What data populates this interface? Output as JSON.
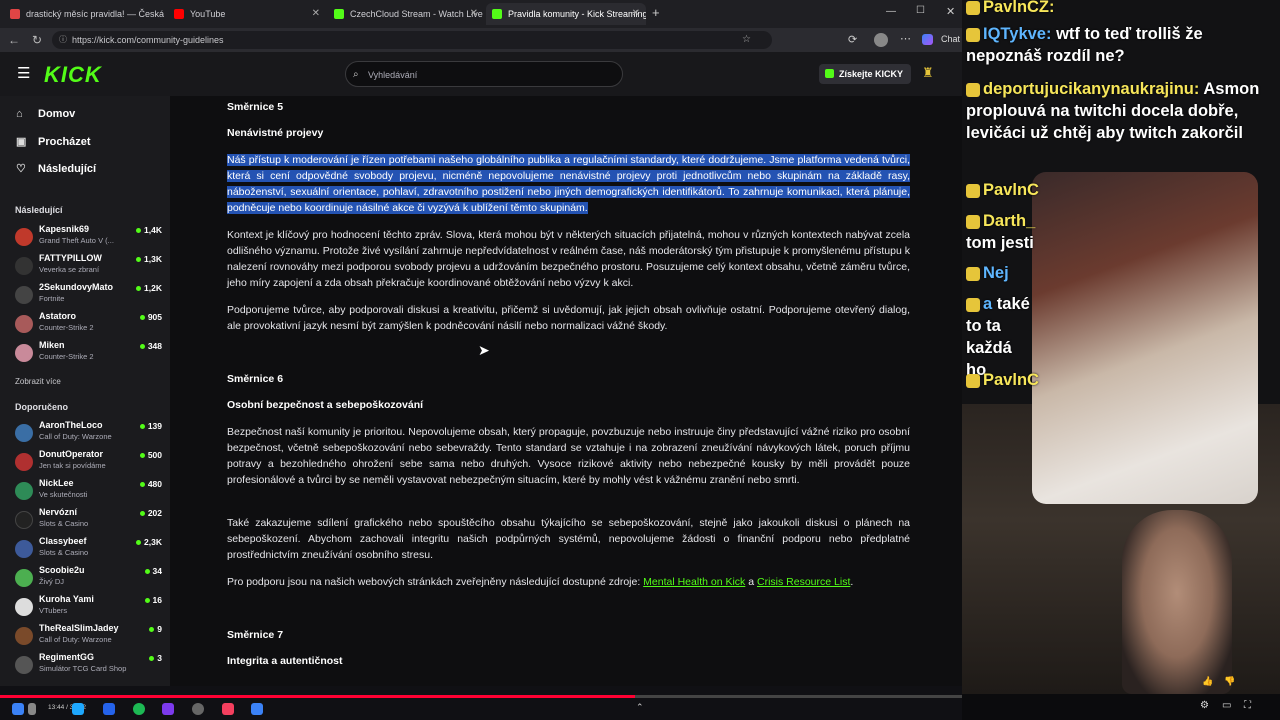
{
  "browser": {
    "tabs": [
      {
        "label": "drastický měsíc pravidla! — Česká t",
        "color": "#e04545"
      },
      {
        "label": "YouTube",
        "color": "#ff0000"
      },
      {
        "label": "CzechCloud Stream - Watch Live o",
        "color": "#53fc18"
      },
      {
        "label": "Pravidla komunity - Kick Streaming",
        "color": "#53fc18"
      }
    ],
    "url": "https://kick.com/community-guidelines",
    "chat_button": "Chat"
  },
  "header": {
    "logo": "KICK",
    "search_placeholder": "Vyhledávání",
    "kicky_button": "Získejte KICKY"
  },
  "sidebar": {
    "nav": [
      {
        "label": "Domov",
        "icon": "home-icon"
      },
      {
        "label": "Procházet",
        "icon": "browse-icon"
      },
      {
        "label": "Následující",
        "icon": "heart-icon"
      }
    ],
    "following_title": "Následující",
    "following": [
      {
        "name": "Kapesnik69",
        "category": "Grand Theft Auto V (...",
        "viewers": "1,4K",
        "color": "#c0392b"
      },
      {
        "name": "FATTYPILLOW",
        "category": "Veverka se zbraní",
        "viewers": "1,3K",
        "color": "#333333"
      },
      {
        "name": "2SekundovyMato",
        "category": "Fortnite",
        "viewers": "1,2K",
        "color": "#444444"
      },
      {
        "name": "Astatoro",
        "category": "Counter-Strike 2",
        "viewers": "905",
        "color": "#a85a5a"
      },
      {
        "name": "Miken",
        "category": "Counter-Strike 2",
        "viewers": "348",
        "color": "#c98a9a"
      }
    ],
    "show_more": "Zobrazit více",
    "recommended_title": "Doporučeno",
    "recommended": [
      {
        "name": "AaronTheLoco",
        "category": "Call of Duty: Warzone",
        "viewers": "139",
        "color": "#3a6ea5"
      },
      {
        "name": "DonutOperator",
        "category": "Jen tak si povídáme",
        "viewers": "500",
        "color": "#b03030"
      },
      {
        "name": "NickLee",
        "category": "Ve skutečnosti",
        "viewers": "480",
        "color": "#2e8b57"
      },
      {
        "name": "Nervózní",
        "category": "Slots & Casino",
        "viewers": "202",
        "color": "#222222"
      },
      {
        "name": "Classybeef",
        "category": "Slots & Casino",
        "viewers": "2,3K",
        "color": "#3d5a9a"
      },
      {
        "name": "Scoobie2u",
        "category": "Živý DJ",
        "viewers": "34",
        "color": "#4caf50"
      },
      {
        "name": "Kuroha Yami",
        "category": "VTubers",
        "viewers": "16",
        "color": "#dddddd"
      },
      {
        "name": "TheRealSlimJadey",
        "category": "Call of Duty: Warzone",
        "viewers": "9",
        "color": "#7a4a2a"
      },
      {
        "name": "RegimentGG",
        "category": "Simulátor TCG Card Shop",
        "viewers": "3",
        "color": "#555555"
      }
    ]
  },
  "content": {
    "s5_title": "Směrnice 5",
    "s5_sub": "Nenávistné projevy",
    "s5_p1": "Náš přístup k moderování je řízen potřebami našeho globálního publika a regulačními standardy, které dodržujeme. Jsme platforma vedená tvůrci, která si cení odpovědné svobody projevu, nicméně nepovolujeme nenávistné projevy proti jednotlivcům nebo skupinám na základě rasy, náboženství, sexuální orientace, pohlaví, zdravotního postižení nebo jiných demografických identifikátorů. To zahrnuje komunikaci, která plánuje, podněcuje nebo koordinuje násilné akce či vyzývá k ublížení těmto skupinám.",
    "s5_p2": "Kontext je klíčový pro hodnocení těchto zpráv. Slova, která mohou být v některých situacích přijatelná, mohou v různých kontextech nabývat zcela odlišného významu. Protože živé vysílání zahrnuje nepředvídatelnost v reálném čase, náš moderátorský tým přistupuje k promyšlenému přístupu k nalezení rovnováhy mezi podporou svobody projevu a udržováním bezpečného prostoru. Posuzujeme celý kontext obsahu, včetně záměru tvůrce, jeho míry zapojení a zda obsah překračuje koordinované obtěžování nebo výzvy k akci.",
    "s5_p3": "Podporujeme tvůrce, aby podporovali diskusi a kreativitu, přičemž si uvědomují, jak jejich obsah ovlivňuje ostatní. Podporujeme otevřený dialog, ale provokativní jazyk nesmí být zamýšlen k podněcování násilí nebo normalizaci vážné škody.",
    "s6_title": "Směrnice 6",
    "s6_sub": "Osobní bezpečnost a sebepoškozování",
    "s6_p1": "Bezpečnost naší komunity je prioritou. Nepovolujeme obsah, který propaguje, povzbuzuje nebo instruuje činy představující vážné riziko pro osobní bezpečnost, včetně sebepoškozování nebo sebevraždy. Tento standard se vztahuje i na zobrazení zneužívání návykových látek, poruch příjmu potravy a bezohledného ohrožení sebe sama nebo druhých. Vysoce rizikové aktivity nebo nebezpečné kousky by měli provádět pouze profesionálové a tvůrci by se neměli vystavovat nebezpečným situacím, které by mohly vést k vážnému zranění nebo smrti.",
    "s6_p2": "Také zakazujeme sdílení grafického nebo spouštěcího obsahu týkajícího se sebepoškozování, stejně jako jakoukoli diskusi o plánech na sebepoškození. Abychom zachovali integritu našich podpůrných systémů, nepovolujeme žádosti o finanční podporu nebo předplatné prostřednictvím zneužívání osobního stresu.",
    "s6_p3_prefix": "Pro podporu jsou na našich webových stránkách zveřejněny následující dostupné zdroje: ",
    "s6_link1": "Mental Health on Kick",
    "s6_p3_mid": " a ",
    "s6_link2": "Crisis Resource List",
    "s6_p3_suffix": ".",
    "s7_title": "Směrnice 7",
    "s7_sub": "Integrita a autentičnost"
  },
  "taskbar": {
    "timecode": "13:44 / 31:52",
    "progress": 0.66
  },
  "overlay_chat": [
    {
      "user": "PavlnCZ:",
      "text": "",
      "blue": false
    },
    {
      "user": "IQTykve:",
      "text": "wtf to teď trolliš že nepoznáš rozdíl ne?",
      "blue": true
    },
    {
      "user": "deportujucikanynaukrajinu:",
      "text": "Asmon proplouvá na twitchi docela dobře, levičáci už chtěj aby twitch zakorčil",
      "blue": false
    },
    {
      "user": "PavlnC",
      "text": "",
      "blue": false
    },
    {
      "user": "Darth_",
      "text": "tom jesti",
      "blue": false
    },
    {
      "user": "Nej",
      "text": "",
      "blue": true
    },
    {
      "user": "a",
      "text": "také to ta každá ho",
      "blue": false
    },
    {
      "user": "PavlnC",
      "text": "",
      "blue": false
    }
  ]
}
